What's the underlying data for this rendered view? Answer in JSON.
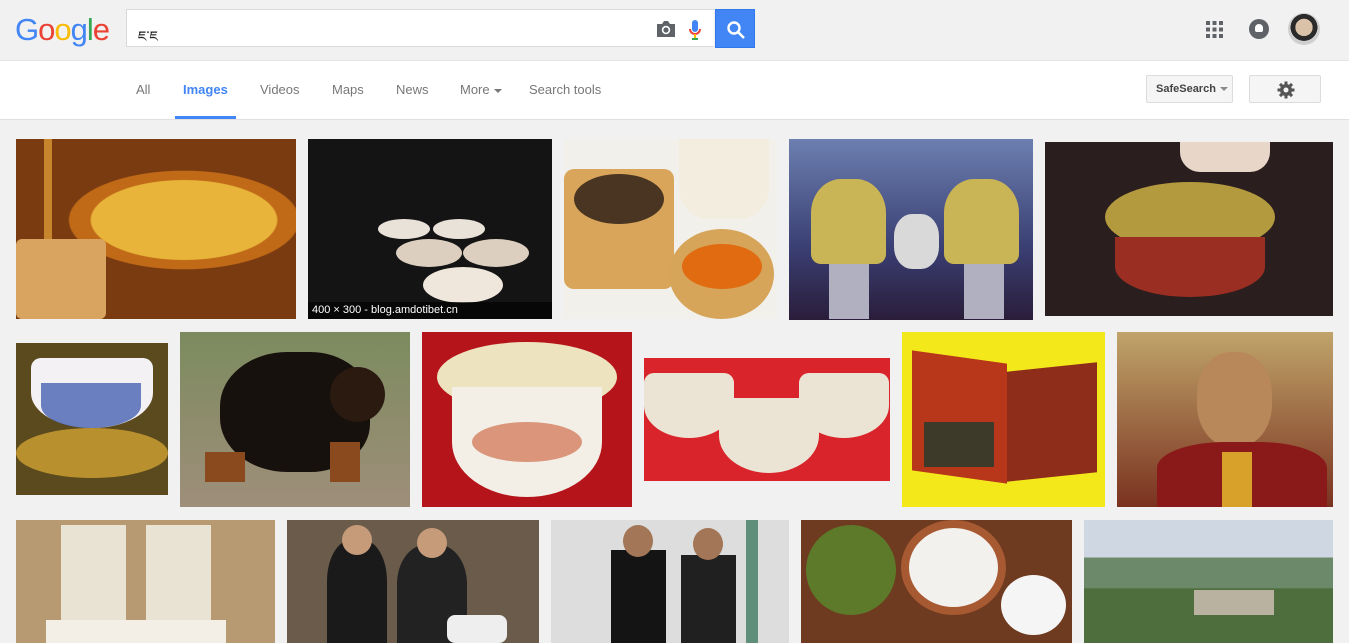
{
  "header": {
    "logo_letters": [
      "G",
      "o",
      "o",
      "g",
      "l",
      "e"
    ],
    "logo_colors": [
      "#4285f4",
      "#ea4335",
      "#fbbc05",
      "#4285f4",
      "#34a853",
      "#ea4335"
    ],
    "query": "ཇ་ཇ",
    "accent": "#4285f4"
  },
  "tabs": {
    "all": "All",
    "images": "Images",
    "videos": "Videos",
    "maps": "Maps",
    "news": "News",
    "more": "More",
    "search_tools": "Search tools"
  },
  "tools": {
    "safesearch": "SafeSearch"
  },
  "results": {
    "caption": "400 × 300 - blog.amdotibet.cn"
  }
}
